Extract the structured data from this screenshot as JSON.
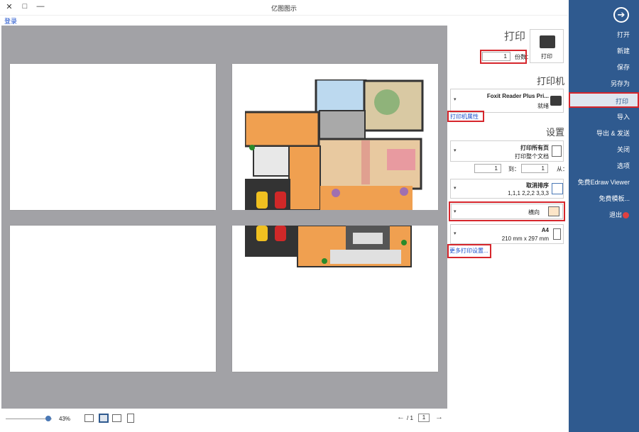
{
  "window": {
    "title": "亿图图示",
    "help": "登录",
    "min": "—",
    "max": "□",
    "close": "✕"
  },
  "sidebar": {
    "items": [
      {
        "label": "打开"
      },
      {
        "label": "新建"
      },
      {
        "label": "保存"
      },
      {
        "label": "另存为"
      },
      {
        "label": "打印"
      },
      {
        "label": "导入"
      },
      {
        "label": "导出 & 发送"
      },
      {
        "label": "关闭"
      },
      {
        "label": "选项"
      },
      {
        "label": "免费Edraw Viewer"
      },
      {
        "label": "免费模板..."
      },
      {
        "label": "退出"
      }
    ]
  },
  "print": {
    "heading": "打印",
    "button_label": "打印",
    "copies_label": "份数：",
    "copies_value": "1",
    "printer_heading": "打印机",
    "printer_name": "Foxit Reader Plus Pri...",
    "printer_status": "就绪",
    "printer_props": "打印机属性",
    "settings_heading": "设置",
    "range_title": "打印所有页",
    "range_sub": "打印整个文档",
    "from_label": "从：",
    "from_value": "1",
    "to_label": "到：",
    "to_value": "1",
    "collate_title": "取消排序",
    "collate_sub": "1,1,1 2,2,2 3,3,3",
    "orientation": "横向",
    "paper_title": "A4",
    "paper_sub": "210 mm x 297 mm",
    "more_settings": "更多打印设置..."
  },
  "bottom": {
    "zoom": "43%",
    "page_current": "1",
    "page_total": "/ 1"
  },
  "colors": {
    "sidebar": "#2f5a8f",
    "highlight": "#d6262c",
    "link": "#1a4ecb",
    "preview_bg": "#a2a2a6"
  }
}
